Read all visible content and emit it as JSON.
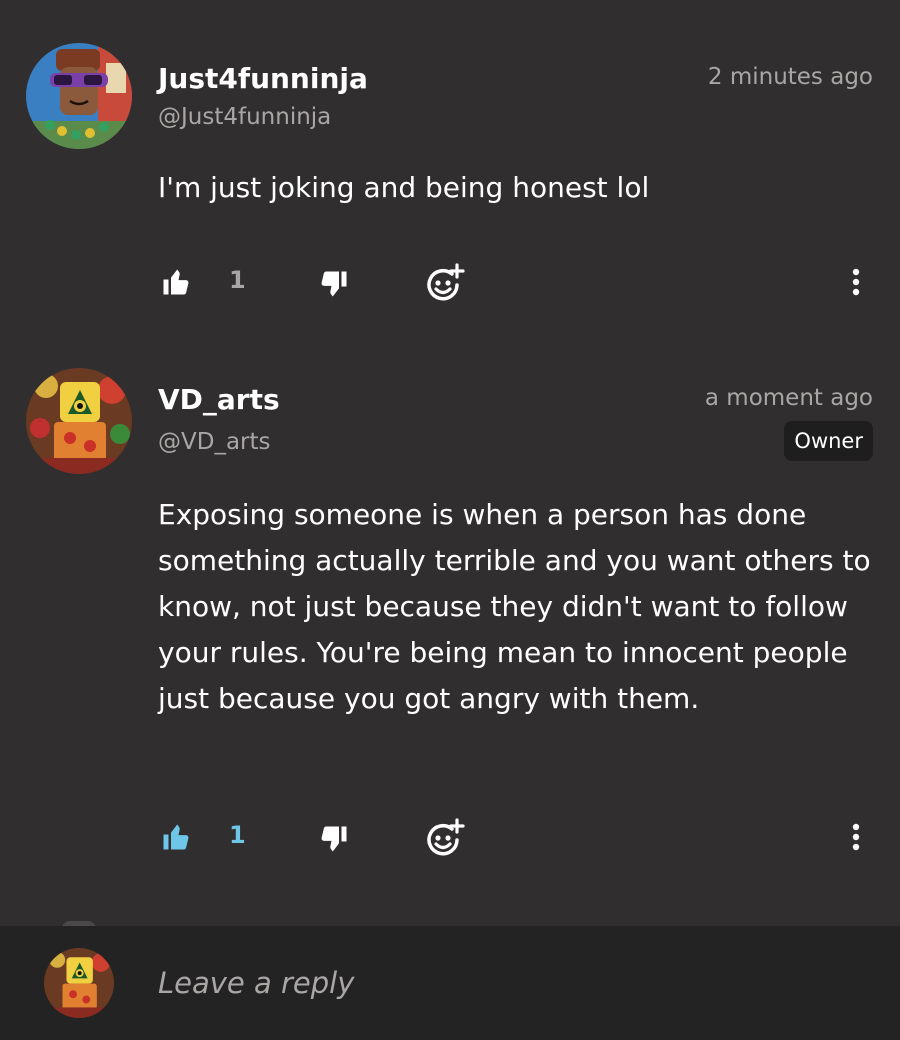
{
  "colors": {
    "background": "#302e2e",
    "reply_bar": "#242323",
    "muted_text": "#a9a6a6",
    "liked_accent": "#6ec6e8",
    "badge_bg": "#1f1e1e"
  },
  "comments": [
    {
      "author_name": "Just4funninja",
      "author_handle": "@Just4funninja",
      "timestamp": "2 minutes ago",
      "body": "I'm  just joking and being honest lol",
      "like_count": "1",
      "liked": false,
      "icons": [
        "thumbs-up-icon",
        "thumbs-down-icon",
        "add-reaction-icon",
        "more-options-icon"
      ]
    },
    {
      "author_name": "VD_arts",
      "author_handle": "@VD_arts",
      "timestamp": "a moment ago",
      "badge": "Owner",
      "body": "Exposing someone is when a person has done something actually terrible and you want others to know, not just because they didn't want to follow your rules. You're being mean to innocent people just because you got angry with them.",
      "like_count": "1",
      "liked": true,
      "icons": [
        "thumbs-up-icon",
        "thumbs-down-icon",
        "add-reaction-icon",
        "more-options-icon"
      ]
    }
  ],
  "reply": {
    "placeholder": "Leave a reply"
  }
}
